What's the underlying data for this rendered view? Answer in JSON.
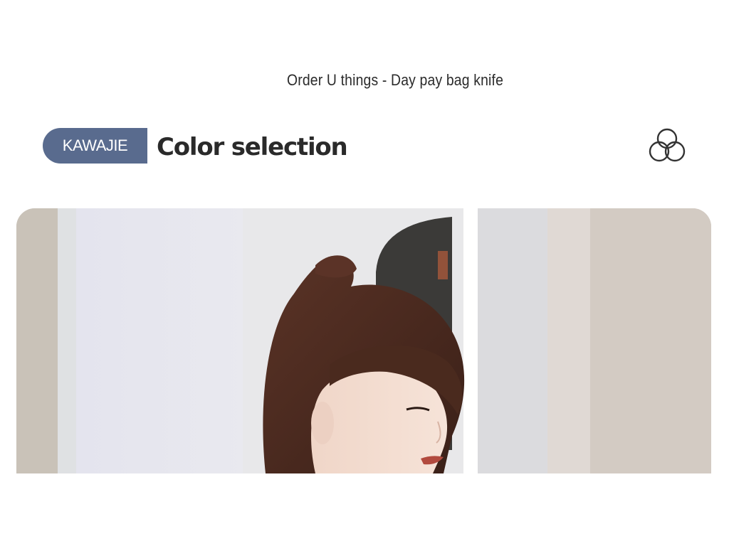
{
  "page": {
    "title": "Order U things - Day pay bag knife"
  },
  "section": {
    "brand": "KAWAJIE",
    "title": "Color selection",
    "icon": "three-rings-icon"
  },
  "product_photo": {
    "icon": "model-photo",
    "colors": {
      "wall": "#e5e5ea",
      "hair": "#4a2a1e",
      "skin": "#f3dccf",
      "lips": "#b24a3e",
      "wood": "#c8beb2"
    }
  }
}
